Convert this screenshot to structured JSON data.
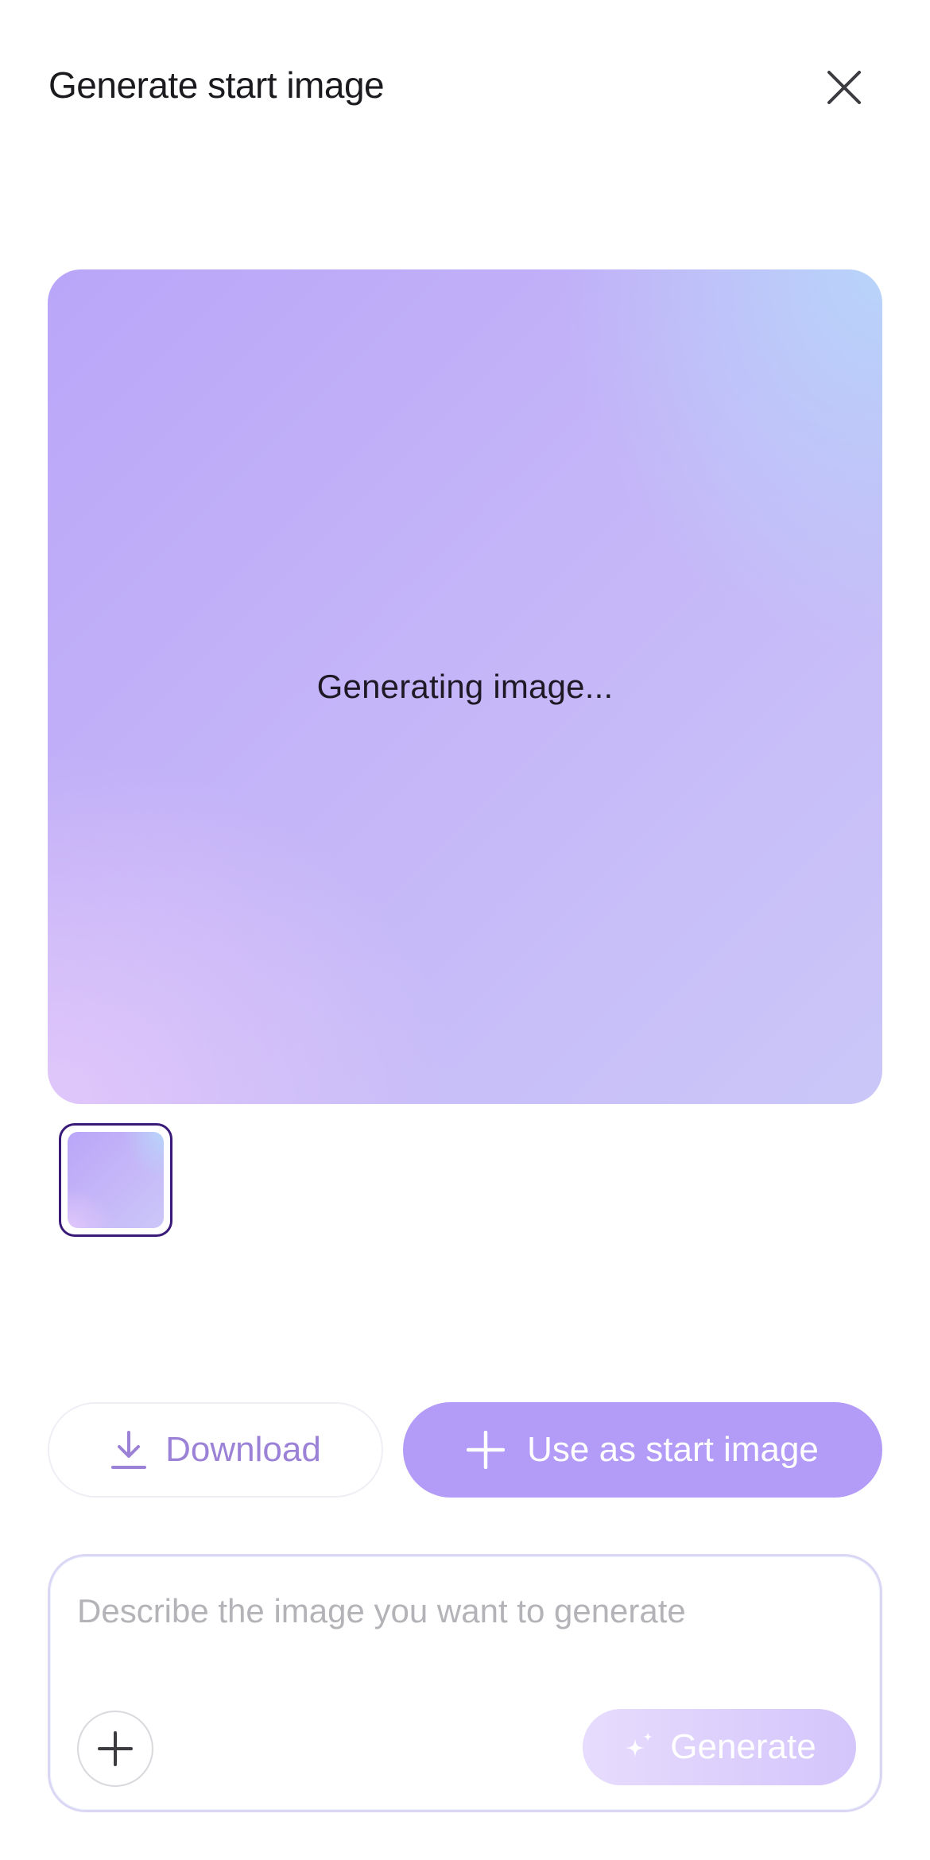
{
  "header": {
    "title": "Generate start image",
    "close_icon": "close-icon"
  },
  "preview": {
    "status_text": "Generating image..."
  },
  "thumbnails": [
    {
      "selected": true
    }
  ],
  "actions": {
    "download_label": "Download",
    "download_icon": "download-icon",
    "use_label": "Use as start image",
    "use_icon": "plus-icon"
  },
  "prompt": {
    "placeholder": "Describe the image you want to generate",
    "value": "",
    "add_icon": "plus-icon",
    "generate_label": "Generate",
    "generate_icon": "sparkle-icon"
  },
  "colors": {
    "accent": "#b39bf8",
    "accent_text": "#9b82d6",
    "selected_border": "#3a1a78"
  }
}
